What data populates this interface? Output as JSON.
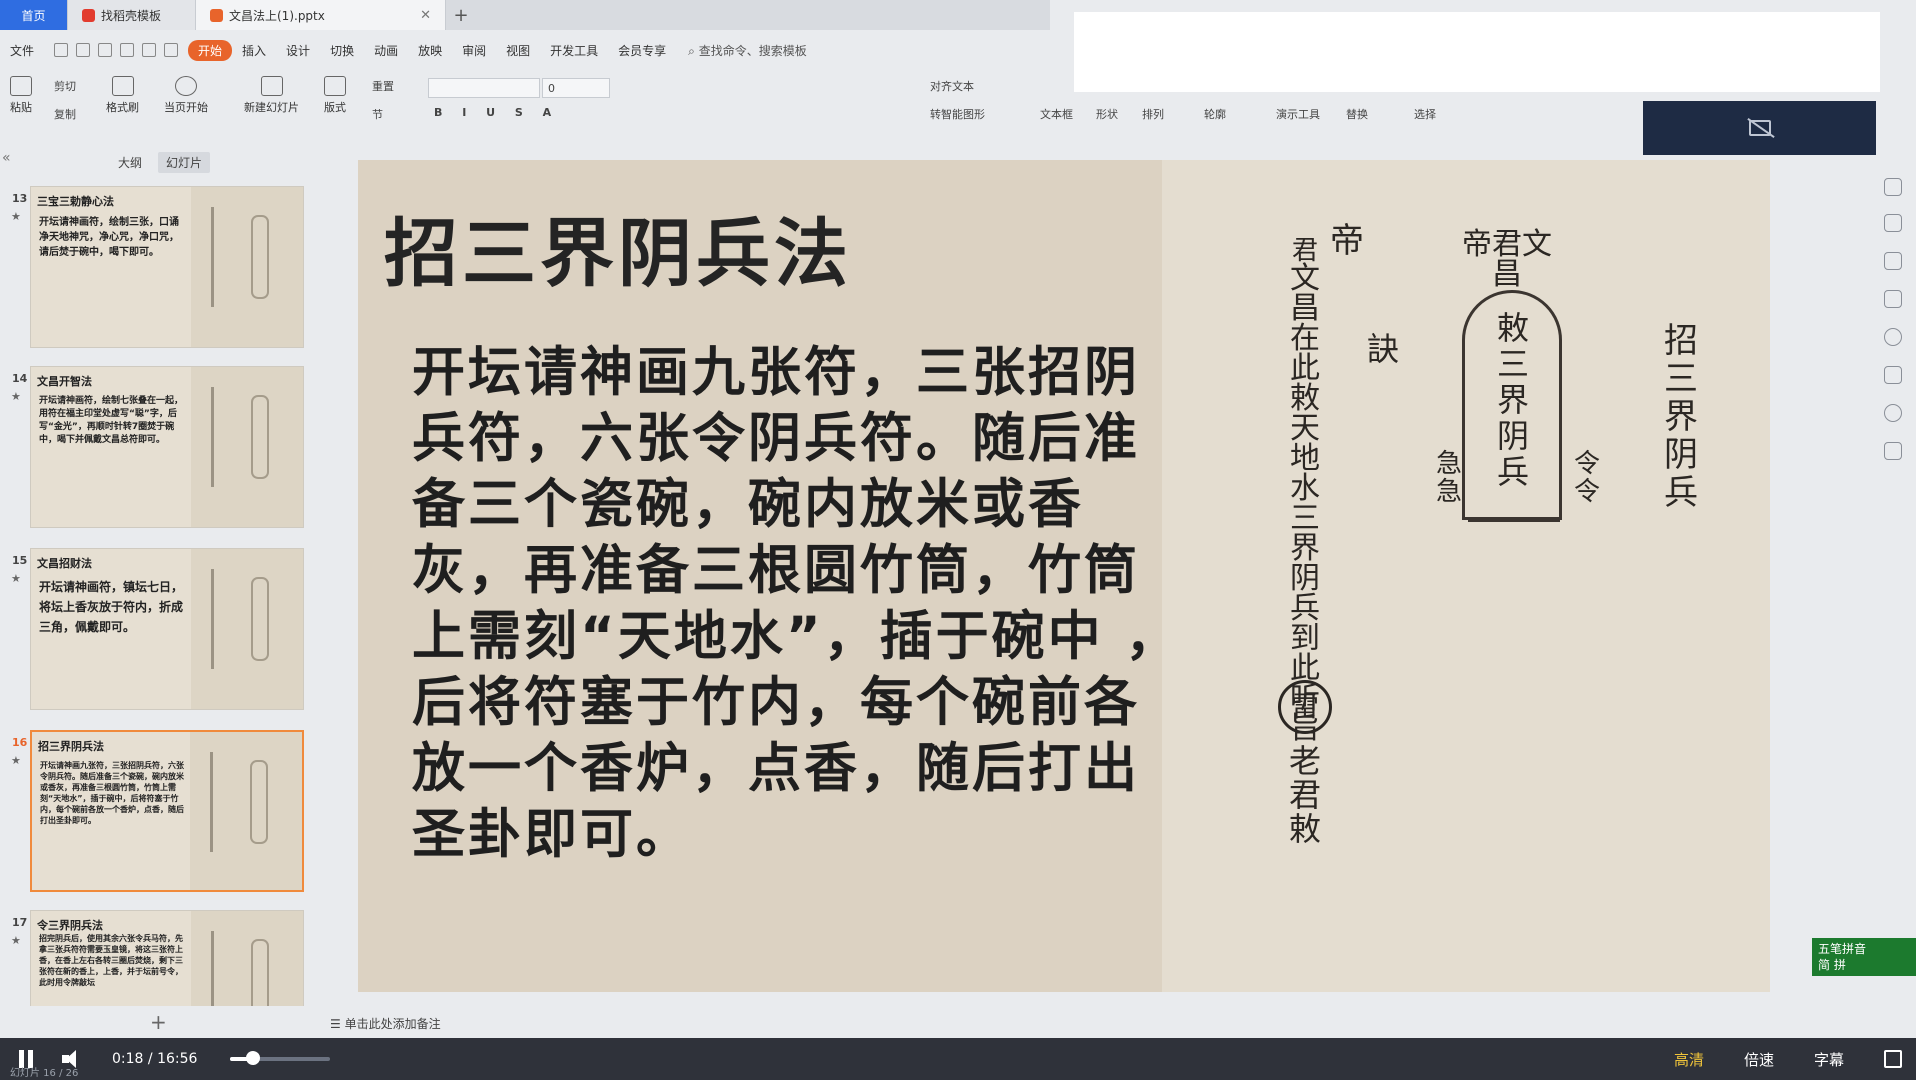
{
  "tabs": {
    "home": "首页",
    "template": "找稻壳模板",
    "file": "文昌法上(1).pptx",
    "new_tab": "+"
  },
  "menu": {
    "file": "文件",
    "start": "开始",
    "insert": "插入",
    "design": "设计",
    "switch": "切换",
    "animation": "动画",
    "play": "放映",
    "review": "审阅",
    "view": "视图",
    "dev": "开发工具",
    "member": "会员专享",
    "search": "查找命令、搜索模板"
  },
  "ribbon": {
    "paste": "粘贴",
    "cut": "剪切",
    "copy": "复制",
    "format_painter": "格式刷",
    "from_start": "当页开始",
    "new_slide": "新建幻灯片",
    "layout": "版式",
    "section": "节",
    "reset": "重置",
    "font_size": "0",
    "align_text": "对齐文本",
    "smartart": "转智能图形",
    "textbox": "文本框",
    "shape": "形状",
    "arrange": "排列",
    "outline": "轮廓",
    "present_tools": "演示工具",
    "replace": "替换",
    "select": "选择"
  },
  "panel": {
    "outline_tab": "大纲",
    "slides_tab": "幻灯片",
    "collapse": "«",
    "add": "+"
  },
  "slides": [
    {
      "num": "13",
      "title": "三宝三勅静心法",
      "text": "开坛请神画符，绘制三张，口诵净天地神咒，净心咒，净口咒，请后焚于碗中，喝下即可。"
    },
    {
      "num": "14",
      "title": "文昌开智法",
      "text": "开坛请神画符，绘制七张叠在一起，用符在福主印堂处虚写“聪”字，后写“金光”，再顺时针转7圈焚于碗中，喝下并佩戴文昌总符即可。"
    },
    {
      "num": "15",
      "title": "文昌招财法",
      "text": "开坛请神画符，镇坛七日，将坛上香灰放于符内，折成三角，佩戴即可。"
    },
    {
      "num": "16",
      "title": "招三界阴兵法",
      "text": "开坛请神画九张符，三张招阴兵符，六张令阴兵符。随后准备三个瓷碗，碗内放米或香灰，再准备三根圆竹筒，竹筒上需刻“天地水”，插于碗中，后将符塞于竹内，每个碗前各放一个香炉，点香，随后打出圣卦即可。"
    },
    {
      "num": "17",
      "title": "令三界阴兵法",
      "text": "招完阴兵后，使用其余六张令兵马符，先拿三张兵符符需要玉皇镜，将这三张符上香，在香上左右各转三圈后焚烧，剩下三张符在新的香上，上香，并于坛前号令，此时用令牌敲坛"
    }
  ],
  "main_slide": {
    "title": "招三界阴兵法",
    "body": "开坛请神画九张符，三张招阴兵符，六张令阴兵符。随后准备三个瓷碗，碗内放米或香灰，再准备三根圆竹筒，竹筒上需刻“天地水”，插于碗中 ，后将符塞于竹内，每个碗前各放一个香炉，点香，随后打出圣卦即可。",
    "talisman": {
      "left_col_top": "帝",
      "left_col_a": "君",
      "left_col_main": "文昌在此敕天地水三界阴兵到此听旨",
      "seal": "雷",
      "left_bottom": "老君敕",
      "jue": "訣",
      "center_top": "帝君文昌",
      "center_main": "敕三界阴兵",
      "center_side_l": "急急",
      "center_side_r": "令令",
      "right_col": "招三界阴兵"
    }
  },
  "notes": "单击此处添加备注",
  "ime": {
    "line1": "五笔拼音",
    "line2": "简 拼"
  },
  "player": {
    "current": "0:18",
    "separator": "/",
    "duration": "16:56",
    "progress_pct": 24,
    "hd": "高清",
    "speed": "倍速",
    "subtitle": "字幕",
    "page_hint": "幻灯片 16 / 26"
  },
  "colors": {
    "accent": "#e8642b",
    "home_tab": "#2f6de1",
    "ime": "#1c7a2e"
  }
}
